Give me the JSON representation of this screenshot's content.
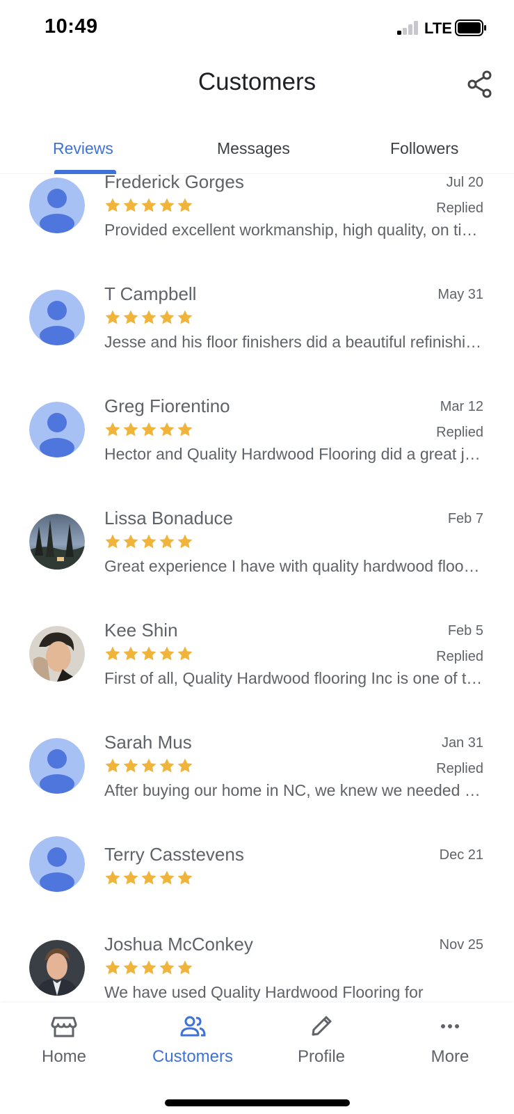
{
  "status_bar": {
    "time": "10:49",
    "network": "LTE"
  },
  "header": {
    "title": "Customers"
  },
  "tabs": [
    {
      "label": "Reviews",
      "active": true
    },
    {
      "label": "Messages",
      "active": false
    },
    {
      "label": "Followers",
      "active": false
    }
  ],
  "reviews": [
    {
      "name": "Frederick Gorges",
      "date": "Jul 20",
      "rating": 5,
      "status": "Replied",
      "snippet": "Provided excellent workmanship, high quality, on time and within budget.",
      "avatar": "default-avatar-icon"
    },
    {
      "name": "T Campbell",
      "date": "May 31",
      "rating": 5,
      "status": "",
      "snippet": "Jesse and his floor finishers did a beautiful refinishing job.",
      "avatar": "default-avatar-icon"
    },
    {
      "name": "Greg Fiorentino",
      "date": "Mar 12",
      "rating": 5,
      "status": "Replied",
      "snippet": "Hector and Quality Hardwood Flooring did a great job.",
      "avatar": "default-avatar-icon"
    },
    {
      "name": "Lissa Bonaduce",
      "date": "Feb 7",
      "rating": 5,
      "status": "",
      "snippet": "Great experience I have with quality hardwood flooring.",
      "avatar": "landscape-photo"
    },
    {
      "name": "Kee Shin",
      "date": "Feb 5",
      "rating": 5,
      "status": "Replied",
      "snippet": "First of all, Quality Hardwood flooring Inc is one of the best.",
      "avatar": "person-photo"
    },
    {
      "name": "Sarah Mus",
      "date": "Jan 31",
      "rating": 5,
      "status": "Replied",
      "snippet": "After buying our home in NC, we knew we needed new floors.",
      "avatar": "default-avatar-icon"
    },
    {
      "name": "Terry Casstevens",
      "date": "Dec 21",
      "rating": 5,
      "status": "",
      "snippet": "",
      "avatar": "default-avatar-icon"
    },
    {
      "name": "Joshua McConkey",
      "date": "Nov 25",
      "rating": 5,
      "status": "",
      "snippet": "We have used Quality Hardwood Flooring for",
      "avatar": "person-photo"
    }
  ],
  "bottom_nav": [
    {
      "label": "Home",
      "icon": "storefront-icon",
      "active": false
    },
    {
      "label": "Customers",
      "icon": "people-icon",
      "active": true
    },
    {
      "label": "Profile",
      "icon": "pencil-icon",
      "active": false
    },
    {
      "label": "More",
      "icon": "more-horizontal-icon",
      "active": false
    }
  ],
  "colors": {
    "accent": "#3f72d8",
    "star": "#f1b43b",
    "avatar_bg": "#a8c1f5",
    "avatar_fg": "#4f76dd",
    "secondary_text": "#5f6368"
  }
}
